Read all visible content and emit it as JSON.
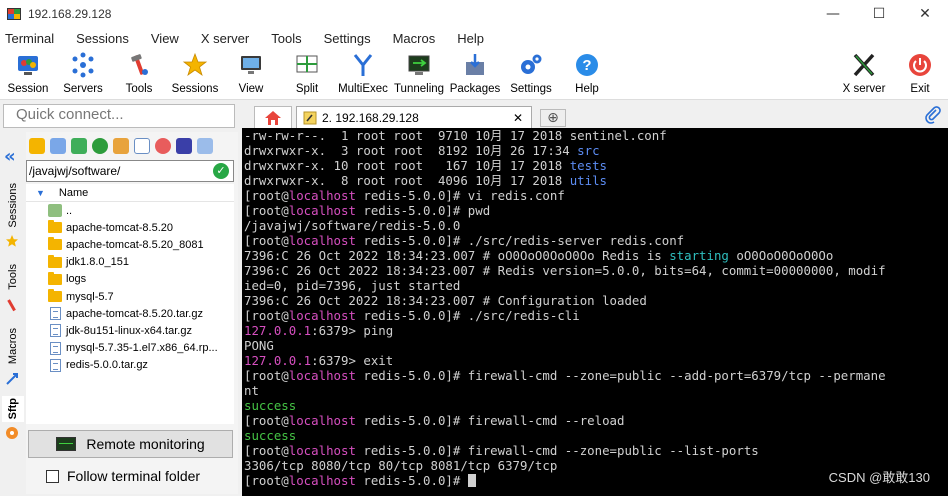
{
  "window": {
    "title": "192.168.29.128",
    "controls": {
      "minimize": "—",
      "maximize": "☐",
      "close": "✕"
    }
  },
  "menu": [
    "Terminal",
    "Sessions",
    "View",
    "X server",
    "Tools",
    "Settings",
    "Macros",
    "Help"
  ],
  "toolbar": {
    "buttons": [
      {
        "label": "Session",
        "icon": "session-icon"
      },
      {
        "label": "Servers",
        "icon": "servers-icon"
      },
      {
        "label": "Tools",
        "icon": "tools-icon"
      },
      {
        "label": "Sessions",
        "icon": "sessions-star-icon"
      },
      {
        "label": "View",
        "icon": "view-icon"
      },
      {
        "label": "Split",
        "icon": "split-icon"
      },
      {
        "label": "MultiExec",
        "icon": "multiexec-icon"
      },
      {
        "label": "Tunneling",
        "icon": "tunneling-icon"
      },
      {
        "label": "Packages",
        "icon": "packages-icon"
      },
      {
        "label": "Settings",
        "icon": "settings-icon"
      },
      {
        "label": "Help",
        "icon": "help-icon"
      }
    ],
    "right_buttons": [
      {
        "label": "X server",
        "icon": "x-server-icon"
      },
      {
        "label": "Exit",
        "icon": "exit-icon"
      }
    ]
  },
  "left_panel": {
    "quick_connect_placeholder": "Quick connect...",
    "side_tabs": [
      "Sessions",
      "Tools",
      "Macros",
      "Sftp"
    ],
    "path": "/javajwj/software/",
    "column_header": "Name",
    "files": [
      {
        "name": "..",
        "type": "up"
      },
      {
        "name": "apache-tomcat-8.5.20",
        "type": "folder"
      },
      {
        "name": "apache-tomcat-8.5.20_8081",
        "type": "folder"
      },
      {
        "name": "jdk1.8.0_151",
        "type": "folder"
      },
      {
        "name": "logs",
        "type": "folder"
      },
      {
        "name": "mysql-5.7",
        "type": "folder"
      },
      {
        "name": "apache-tomcat-8.5.20.tar.gz",
        "type": "file"
      },
      {
        "name": "jdk-8u151-linux-x64.tar.gz",
        "type": "file"
      },
      {
        "name": "mysql-5.7.35-1.el7.x86_64.rp...",
        "type": "file"
      },
      {
        "name": "redis-5.0.0.tar.gz",
        "type": "file"
      }
    ],
    "remote_monitoring_label": "Remote monitoring",
    "follow_terminal_label": "Follow terminal folder"
  },
  "tabs": {
    "session_tab_label": "2. 192.168.29.128",
    "close_glyph": "✕"
  },
  "terminal": {
    "lines": [
      [
        {
          "t": "-rw-rw-r--.  1 root root  9710 10月 17 2018 sentinel.conf"
        }
      ],
      [
        {
          "t": "drwxrwxr-x.  3 root root  8192 10月 26 17:34 "
        },
        {
          "t": "src",
          "c": "blue"
        }
      ],
      [
        {
          "t": "drwxrwxr-x. 10 root root   167 10月 17 2018 "
        },
        {
          "t": "tests",
          "c": "blue"
        }
      ],
      [
        {
          "t": "drwxrwxr-x.  8 root root  4096 10月 17 2018 "
        },
        {
          "t": "utils",
          "c": "blue"
        }
      ],
      [
        {
          "t": "[root@"
        },
        {
          "t": "localhost",
          "c": "pink"
        },
        {
          "t": " redis-5.0.0]# vi redis.conf"
        }
      ],
      [
        {
          "t": "[root@"
        },
        {
          "t": "localhost",
          "c": "pink"
        },
        {
          "t": " redis-5.0.0]# pwd"
        }
      ],
      [
        {
          "t": "/javajwj/software/redis-5.0.0"
        }
      ],
      [
        {
          "t": "[root@"
        },
        {
          "t": "localhost",
          "c": "pink"
        },
        {
          "t": " redis-5.0.0]# ./src/redis-server redis.conf"
        }
      ],
      [
        {
          "t": "7396:C 26 Oct 2022 18:34:23.007 # oO0OoO0OoO0Oo Redis is "
        },
        {
          "t": "starting",
          "c": "cyan"
        },
        {
          "t": " oO0OoO0OoO0Oo"
        }
      ],
      [
        {
          "t": "7396:C 26 Oct 2022 18:34:23.007 # Redis version=5.0.0, bits=64, commit=00000000, modif"
        }
      ],
      [
        {
          "t": "ied=0, pid=7396, just started"
        }
      ],
      [
        {
          "t": "7396:C 26 Oct 2022 18:34:23.007 # Configuration loaded"
        }
      ],
      [
        {
          "t": "[root@"
        },
        {
          "t": "localhost",
          "c": "pink"
        },
        {
          "t": " redis-5.0.0]# ./src/redis-cli"
        }
      ],
      [
        {
          "t": "127.0.0.1",
          "c": "pink"
        },
        {
          "t": ":6379> ping"
        }
      ],
      [
        {
          "t": "PONG"
        }
      ],
      [
        {
          "t": "127.0.0.1",
          "c": "pink"
        },
        {
          "t": ":6379> exit"
        }
      ],
      [
        {
          "t": "[root@"
        },
        {
          "t": "localhost",
          "c": "pink"
        },
        {
          "t": " redis-5.0.0]# firewall-cmd --zone=public --add-port=6379/tcp --permane"
        }
      ],
      [
        {
          "t": "nt"
        }
      ],
      [
        {
          "t": "success",
          "c": "green"
        }
      ],
      [
        {
          "t": "[root@"
        },
        {
          "t": "localhost",
          "c": "pink"
        },
        {
          "t": " redis-5.0.0]# firewall-cmd --reload"
        }
      ],
      [
        {
          "t": "success",
          "c": "green"
        }
      ],
      [
        {
          "t": "[root@"
        },
        {
          "t": "localhost",
          "c": "pink"
        },
        {
          "t": " redis-5.0.0]# firewall-cmd --zone=public --list-ports"
        }
      ],
      [
        {
          "t": "3306/tcp 8080/tcp 80/tcp 8081/tcp 6379/tcp"
        }
      ],
      [
        {
          "t": "[root@"
        },
        {
          "t": "localhost",
          "c": "pink"
        },
        {
          "t": " redis-5.0.0]# "
        },
        {
          "cursor": true
        }
      ]
    ],
    "watermark": "CSDN @敢敢130"
  },
  "colors": {
    "term_bg": "#000000",
    "term_fg": "#d0d0d0",
    "blue": "#5c8cf2",
    "cyan": "#2fbfbf",
    "pink": "#d64fc0",
    "green": "#45c445"
  }
}
